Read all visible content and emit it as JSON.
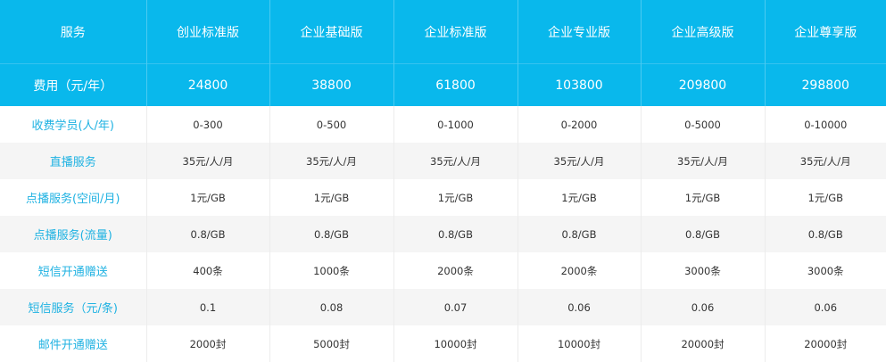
{
  "header": {
    "service_label": "服务",
    "plans": [
      "创业标准版",
      "企业基础版",
      "企业标准版",
      "企业专业版",
      "企业高级版",
      "企业尊享版"
    ]
  },
  "price_row": {
    "label": "费用（元/年）",
    "values": [
      "24800",
      "38800",
      "61800",
      "103800",
      "209800",
      "298800"
    ]
  },
  "rows": [
    {
      "label": "收费学员(人/年)",
      "values": [
        "0-300",
        "0-500",
        "0-1000",
        "0-2000",
        "0-5000",
        "0-10000"
      ]
    },
    {
      "label": "直播服务",
      "values": [
        "35元/人/月",
        "35元/人/月",
        "35元/人/月",
        "35元/人/月",
        "35元/人/月",
        "35元/人/月"
      ]
    },
    {
      "label": "点播服务(空间/月)",
      "values": [
        "1元/GB",
        "1元/GB",
        "1元/GB",
        "1元/GB",
        "1元/GB",
        "1元/GB"
      ]
    },
    {
      "label": "点播服务(流量)",
      "values": [
        "0.8/GB",
        "0.8/GB",
        "0.8/GB",
        "0.8/GB",
        "0.8/GB",
        "0.8/GB"
      ]
    },
    {
      "label": "短信开通赠送",
      "values": [
        "400条",
        "1000条",
        "2000条",
        "2000条",
        "3000条",
        "3000条"
      ]
    },
    {
      "label": "短信服务（元/条)",
      "values": [
        "0.1",
        "0.08",
        "0.07",
        "0.06",
        "0.06",
        "0.06"
      ]
    },
    {
      "label": "邮件开通赠送",
      "values": [
        "2000封",
        "5000封",
        "10000封",
        "10000封",
        "20000封",
        "20000封"
      ]
    }
  ],
  "colors": {
    "header_bg": "#09b8ec",
    "label_text": "#1fb2e2",
    "stripe_bg": "#f5f5f5"
  }
}
